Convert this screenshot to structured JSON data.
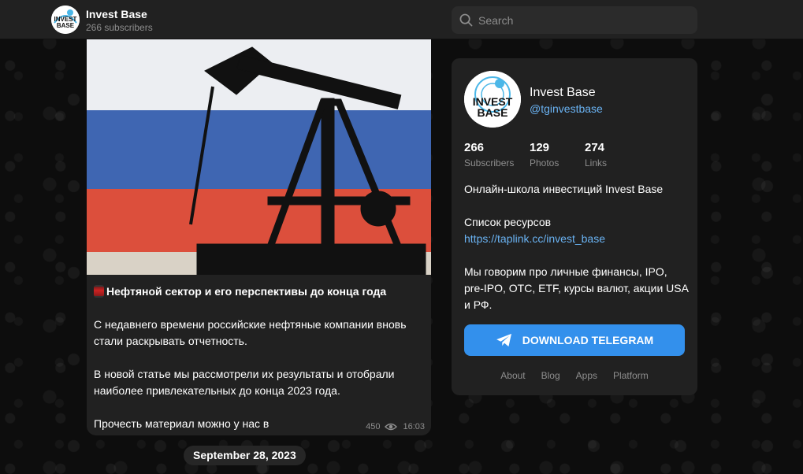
{
  "header": {
    "channel_name": "Invest Base",
    "subscribers": "266 subscribers"
  },
  "search": {
    "placeholder": "Search"
  },
  "post": {
    "headline": "Нефтяной сектор и его перспективы до конца года",
    "paragraphs": [
      "С недавнего времени российские нефтяные компании вновь стали раскрывать отчетность.",
      "В новой статье мы рассмотрели их результаты и отобрали наиболее привлекательных до конца 2023 года.",
      "Прочесть материал можно у нас в"
    ],
    "views": "450",
    "time": "16:03"
  },
  "date_divider": "September 28, 2023",
  "channel_card": {
    "logo_text": [
      "INVEST",
      "BASE"
    ],
    "name": "Invest Base",
    "handle": "@tginvestbase",
    "stats": [
      {
        "value": "266",
        "label": "Subscribers"
      },
      {
        "value": "129",
        "label": "Photos"
      },
      {
        "value": "274",
        "label": "Links"
      }
    ],
    "description": {
      "line1": "Онлайн-школа инвестиций Invest Base",
      "resources_label": "Список ресурсов",
      "link": "https://taplink.cc/invest_base",
      "line3": "Мы говорим про личные финансы, IPO, pre-IPO, OTC, ETF, курсы валют, акции USA и РФ."
    },
    "download_button": "DOWNLOAD TELEGRAM",
    "footer_links": [
      "About",
      "Blog",
      "Apps",
      "Platform"
    ]
  },
  "colors": {
    "accent": "#3390ec",
    "link": "#6ab3f3",
    "panel": "#212121"
  },
  "icons": [
    "search-icon",
    "barrel-emoji-icon",
    "eye-icon",
    "telegram-plane-icon"
  ]
}
